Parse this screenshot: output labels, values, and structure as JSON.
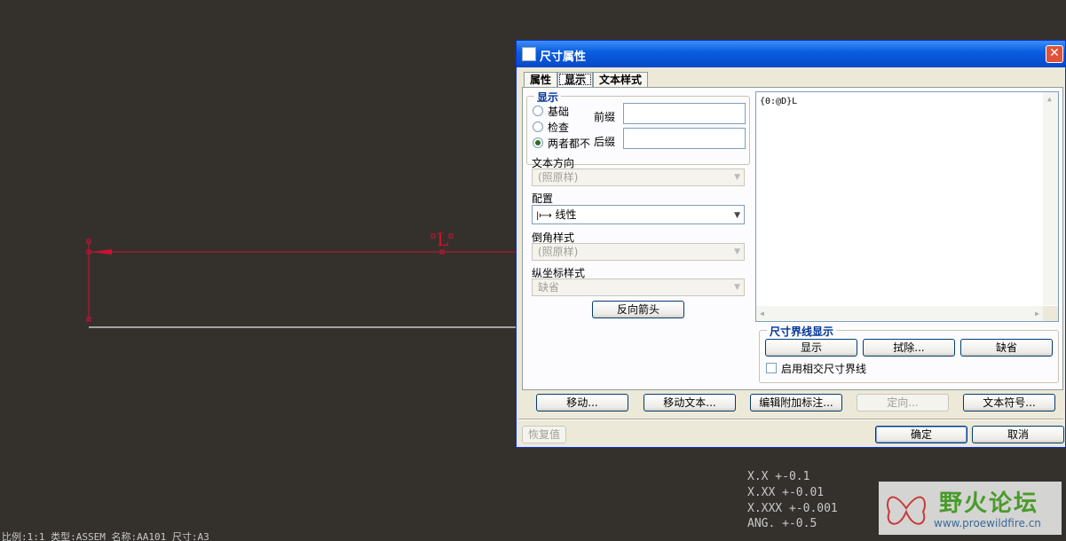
{
  "dialog": {
    "title": "尺寸属性",
    "tabs": [
      "属性",
      "显示",
      "文本样式"
    ],
    "active_tab": "显示"
  },
  "display_group": {
    "title": "显示",
    "radios": [
      {
        "label": "基础",
        "checked": false
      },
      {
        "label": "检查",
        "checked": false
      },
      {
        "label": "两者都不",
        "checked": true
      }
    ],
    "prefix_label": "前缀",
    "prefix_value": "",
    "suffix_label": "后缀",
    "suffix_value": ""
  },
  "text_direction": {
    "label": "文本方向",
    "value": "(照原样)",
    "disabled": true
  },
  "config": {
    "label": "配置",
    "value": "线性",
    "icon": "linear-dimension-icon"
  },
  "chamfer_style": {
    "label": "倒角样式",
    "value": "(照原样)",
    "disabled": true
  },
  "ordinate_style": {
    "label": "纵坐标样式",
    "value": "缺省",
    "disabled": true
  },
  "reverse_arrow_button": "反向箭头",
  "text_content": "{0:@D}L",
  "witness_line": {
    "title": "尺寸界线显示",
    "show_button": "显示",
    "erase_button": "拭除...",
    "default_button": "缺省",
    "intersect_checkbox": "启用相交尺寸界线",
    "intersect_checked": false
  },
  "bottom_buttons": {
    "move": "移动...",
    "move_text": "移动文本...",
    "edit_attach": "编辑附加标注...",
    "orient": "定向...",
    "text_symbol": "文本符号..."
  },
  "footer": {
    "restore": "恢复值",
    "ok": "确定",
    "cancel": "取消"
  },
  "canvas": {
    "dimension_text": "L",
    "tolerance_table": [
      "X.X    +-0.1",
      "X.XX   +-0.01",
      "X.XXX  +-0.001",
      "ANG.   +-0.5"
    ],
    "status_bar": "比例:1:1    类型:ASSEM   名称:AA101   尺寸:A3"
  },
  "watermark": {
    "title": "野火论坛",
    "url": "www.proewildfire.cn"
  },
  "colors": {
    "canvas_bg": "#34312d",
    "dimension": "#d01030",
    "title_bar": "#0a5fe0"
  }
}
